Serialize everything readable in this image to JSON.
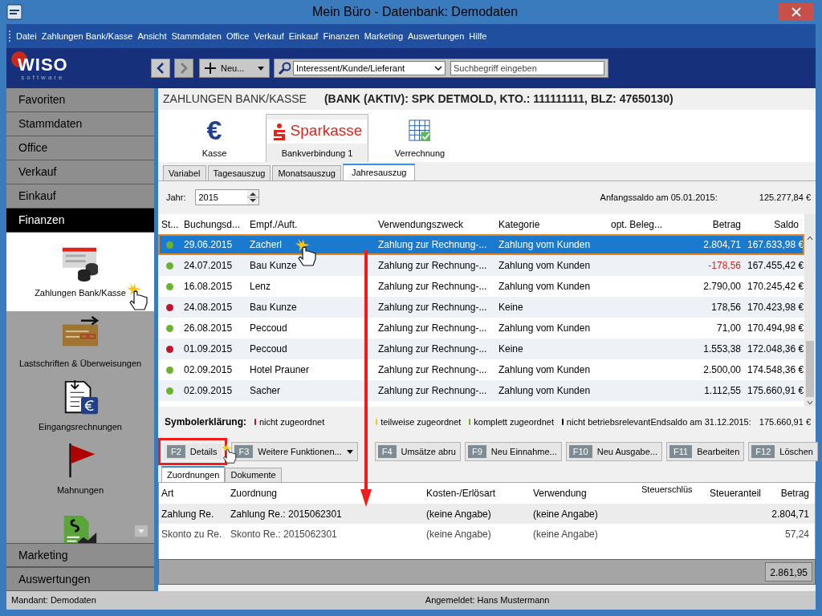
{
  "window": {
    "title": "Mein Büro - Datenbank: Demodaten"
  },
  "menu": [
    "Datei",
    "Zahlungen Bank/Kasse",
    "Ansicht",
    "Stammdaten",
    "Office",
    "Verkauf",
    "Einkauf",
    "Finanzen",
    "Marketing",
    "Auswertungen",
    "Hilfe"
  ],
  "toolbar": {
    "logo": {
      "name": "WISO",
      "sub": "software"
    },
    "new_button": "Neu...",
    "search_scope": "Interessent/Kunde/Lieferant",
    "search": {
      "placeholder": "Suchbegriff eingeben"
    }
  },
  "sidebar": {
    "groups_top": [
      {
        "label": "Favoriten",
        "selected": false
      },
      {
        "label": "Stammdaten",
        "selected": false
      },
      {
        "label": "Office",
        "selected": false
      },
      {
        "label": "Verkauf",
        "selected": false
      },
      {
        "label": "Einkauf",
        "selected": false
      },
      {
        "label": "Finanzen",
        "selected": true
      }
    ],
    "items": [
      {
        "kind": "payments",
        "label": "Zahlungen Bank/Kasse",
        "selected": true
      },
      {
        "kind": "transfer",
        "label": "Lastschriften & Überweisungen",
        "selected": false
      },
      {
        "kind": "invoice",
        "label": "Eingangsrechnungen",
        "selected": false
      },
      {
        "kind": "flag",
        "label": "Mahnungen",
        "selected": false
      },
      {
        "kind": "report",
        "selected": false
      }
    ],
    "groups_bottom": [
      {
        "label": "Marketing",
        "selected": false
      },
      {
        "label": "Auswertungen",
        "selected": false
      }
    ]
  },
  "header": {
    "title": "ZAHLUNGEN BANK/KASSE",
    "account": "(BANK (AKTIV): SPK DETMOLD, KTO.: 111111111, BLZ: 47650130)"
  },
  "accounts": [
    {
      "kind": "cash",
      "symbol": "€",
      "label": "Kasse",
      "selected": false
    },
    {
      "kind": "bank",
      "logo": "Sparkasse",
      "label": "Bankverbindung 1",
      "selected": true
    },
    {
      "kind": "clearing",
      "label": "Verrechnung",
      "selected": false
    }
  ],
  "tabs": [
    {
      "label": "Variabel",
      "selected": false
    },
    {
      "label": "Tagesauszug",
      "selected": false
    },
    {
      "label": "Monatsauszug",
      "selected": false
    },
    {
      "label": "Jahresauszug",
      "selected": true
    }
  ],
  "year": {
    "label": "Jahr:",
    "value": "2015"
  },
  "opening": {
    "label": "Anfangssaldo am 05.01.2015:",
    "value": "125.277,84 €"
  },
  "table": {
    "columns": [
      "St...",
      "Buchungsd...",
      "Empf./Auft.",
      "Verwendungszweck",
      "Kategorie",
      "opt. Beleg...",
      "Betrag",
      "Saldo"
    ],
    "rows": [
      {
        "color": "#6ab42d",
        "date": "29.06.2015",
        "payee": "Zacherl",
        "purpose": "Zahlung zur Rechnung-...",
        "category": "Zahlung vom Kunden",
        "amount": "2.804,71",
        "negative": false,
        "balance": "167.633,98 €",
        "selected": true
      },
      {
        "color": "#6ab42d",
        "date": "24.07.2015",
        "payee": "Bau Kunze",
        "purpose": "Zahlung zur Rechnung-...",
        "category": "Zahlung vom Kunden",
        "amount": "-178,56",
        "negative": true,
        "balance": "167.455,42 €",
        "selected": false
      },
      {
        "color": "#6ab42d",
        "date": "16.08.2015",
        "payee": "Lenz",
        "purpose": "Zahlung zur Rechnung-...",
        "category": "Zahlung vom Kunden",
        "amount": "2.790,00",
        "negative": false,
        "balance": "170.245,42 €",
        "selected": false
      },
      {
        "color": "#c0142c",
        "date": "24.08.2015",
        "payee": "Bau Kunze",
        "purpose": "Zahlung zur Rechnung-...",
        "category": "Keine",
        "amount": "178,56",
        "negative": false,
        "balance": "170.423,98 €",
        "selected": false
      },
      {
        "color": "#6ab42d",
        "date": "26.08.2015",
        "payee": "Peccoud",
        "purpose": "Zahlung zur Rechnung-...",
        "category": "Zahlung vom Kunden",
        "amount": "71,00",
        "negative": false,
        "balance": "170.494,98 €",
        "selected": false
      },
      {
        "color": "#c0142c",
        "date": "01.09.2015",
        "payee": "Peccoud",
        "purpose": "Zahlung zur Rechnung-...",
        "category": "Keine",
        "amount": "1.553,38",
        "negative": false,
        "balance": "172.048,36 €",
        "selected": false
      },
      {
        "color": "#6ab42d",
        "date": "02.09.2015",
        "payee": "Hotel Prauner",
        "purpose": "Zahlung zur Rechnung-...",
        "category": "Zahlung vom Kunden",
        "amount": "2.500,00",
        "negative": false,
        "balance": "174.548,36 €",
        "selected": false
      },
      {
        "color": "#6ab42d",
        "date": "02.09.2015",
        "payee": "Sacher",
        "purpose": "Zahlung zur Rechnung-...",
        "category": "Zahlung vom Kunden",
        "amount": "1.112,55",
        "negative": false,
        "balance": "175.660,91 €",
        "selected": false
      }
    ]
  },
  "legend": {
    "title": "Symbolerklärung:",
    "items": [
      {
        "color": "#c0142c",
        "label": "nicht zugeordnet"
      },
      {
        "color": "#f4c430",
        "label": "teilweise zugeordnet"
      },
      {
        "color": "#6ab42d",
        "label": "komplett zugeordnet"
      },
      {
        "color": "#000000",
        "label": "nicht betriebsrelevant"
      }
    ]
  },
  "closing": {
    "label": "Endsaldo am 31.12.2015:",
    "value": "175.660,91 €"
  },
  "buttons": [
    {
      "key": "F2",
      "label": "Details",
      "highlighted": true
    },
    {
      "key": "F3",
      "label": "Weitere Funktionen...",
      "dropdown": true,
      "highlighted": false
    },
    {
      "key": "F4",
      "label": "Umsätze abru",
      "highlighted": false
    },
    {
      "key": "F9",
      "label": "Neu Einnahme...",
      "highlighted": false
    },
    {
      "key": "F10",
      "label": "Neu Ausgabe...",
      "highlighted": false
    },
    {
      "key": "F11",
      "label": "Bearbeiten",
      "highlighted": false
    },
    {
      "key": "F12",
      "label": "Löschen",
      "highlighted": false
    }
  ],
  "detail_tabs": [
    {
      "label": "Zuordnungen",
      "selected": true
    },
    {
      "label": "Dokumente",
      "selected": false
    }
  ],
  "detail_table": {
    "columns": [
      "Art",
      "Zuordnung",
      "Kosten-/Erlösart",
      "Verwendung",
      "Steuerschlüs",
      "Steueranteil",
      "Betrag"
    ],
    "rows": [
      {
        "cells": [
          "Zahlung Re.",
          "Zahlung Re.: 2015062301",
          "(keine Angabe)",
          "(keine Angabe)",
          "",
          "",
          "2.804,71"
        ],
        "selected": true
      },
      {
        "cells": [
          "Skonto zu Re.",
          "Skonto Re.: 2015062301",
          "(keine Angabe)",
          "(keine Angabe)",
          "",
          "",
          "57,24"
        ],
        "selected": false
      }
    ],
    "total": "2.861,95"
  },
  "status_bar": {
    "client": "Mandant: Demodaten",
    "user": "Angemeldet: Hans Mustermann"
  }
}
